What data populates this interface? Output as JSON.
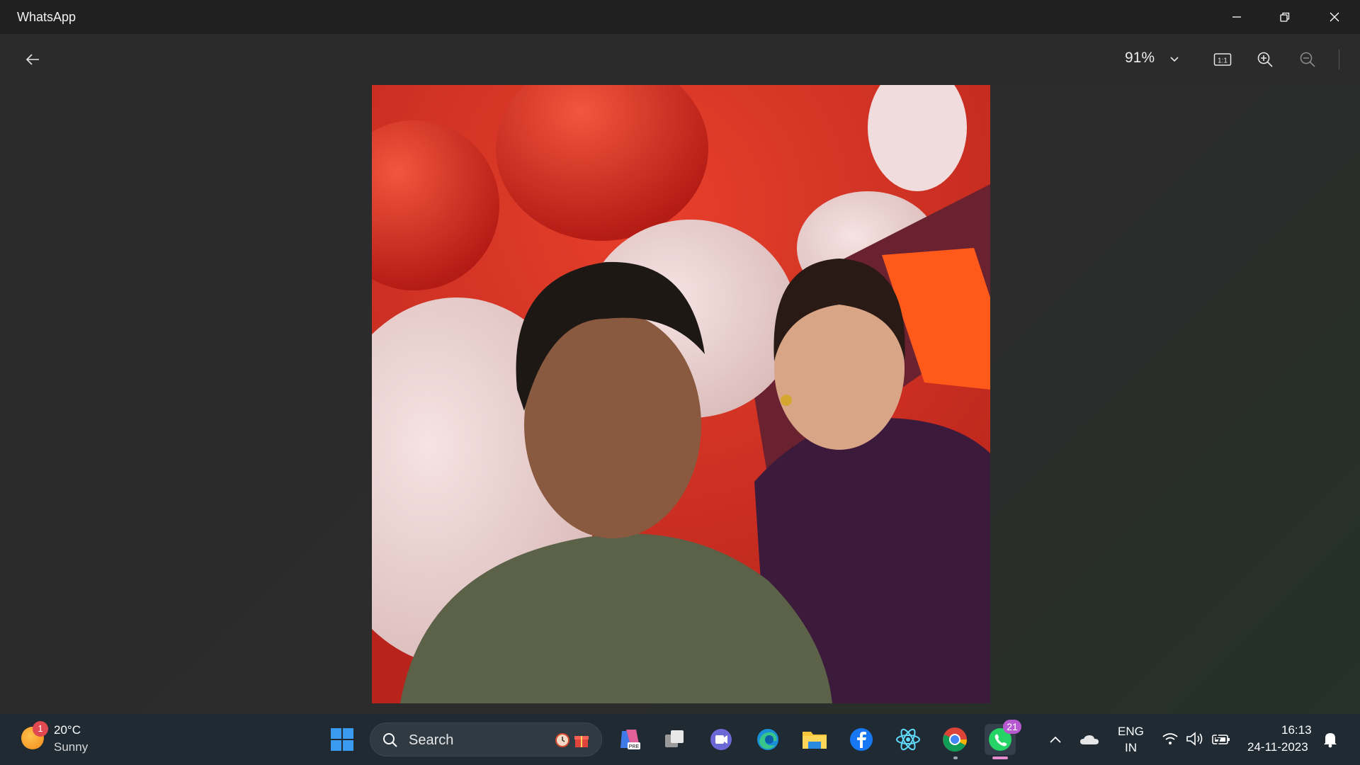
{
  "window": {
    "title": "WhatsApp"
  },
  "toolbar": {
    "zoom_value": "91%"
  },
  "weather": {
    "temp": "20°C",
    "condition": "Sunny",
    "badge": "1"
  },
  "taskbar": {
    "search_placeholder": "Search",
    "whatsapp_badge": "21",
    "lang_top": "ENG",
    "lang_bottom": "IN",
    "time": "16:13",
    "date": "24-11-2023"
  },
  "colors": {
    "accent": "#0078d4",
    "whatsapp": "#25d366",
    "badge_red": "#e81123",
    "badge_purple": "#b658d0"
  },
  "icons": [
    "back-arrow-icon",
    "chevron-down-icon",
    "actual-size-icon",
    "zoom-in-icon",
    "zoom-out-icon",
    "minimize-icon",
    "restore-icon",
    "close-icon",
    "windows-start-icon",
    "search-icon",
    "copilot-icon",
    "task-view-icon",
    "teams-icon",
    "edge-icon",
    "file-explorer-icon",
    "facebook-icon",
    "react-icon",
    "chrome-icon",
    "whatsapp-icon",
    "show-hidden-icons-icon",
    "onedrive-icon",
    "wifi-icon",
    "volume-icon",
    "battery-icon",
    "notification-bell-icon"
  ]
}
